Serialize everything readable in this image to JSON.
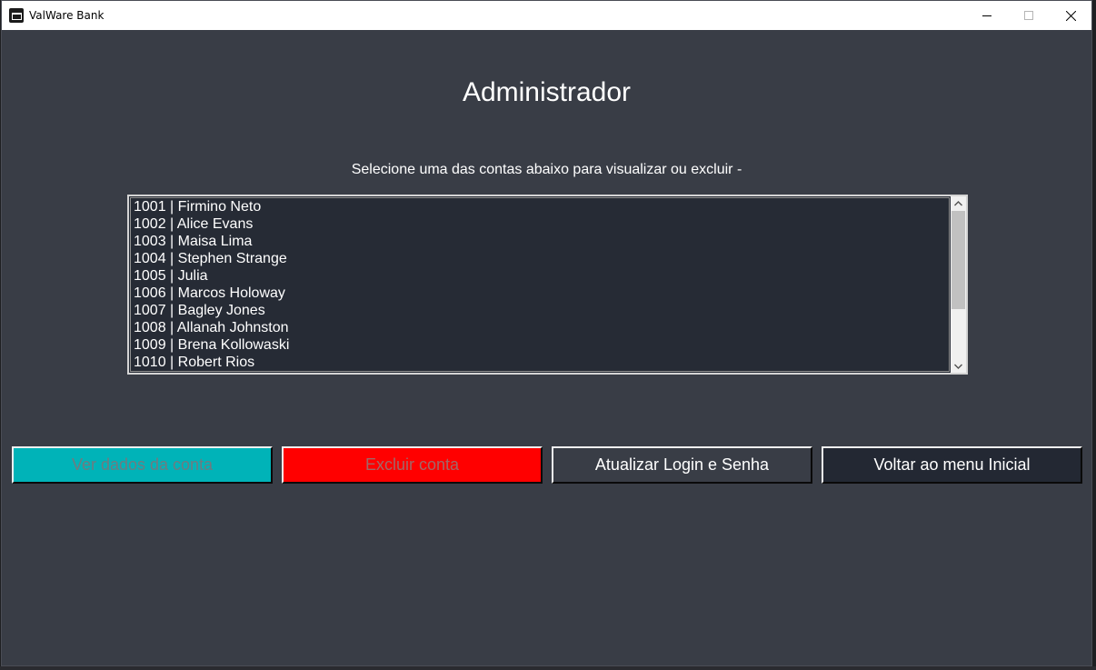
{
  "window": {
    "title": "ValWare Bank"
  },
  "page": {
    "heading": "Administrador",
    "instruction": "Selecione uma das contas abaixo para visualizar ou excluir -"
  },
  "accounts": [
    "1001 | Firmino Neto",
    "1002 | Alice Evans",
    "1003 | Maisa Lima",
    "1004 | Stephen Strange",
    "1005 | Julia",
    "1006 | Marcos Holoway",
    "1007 | Bagley Jones",
    "1008 | Allanah Johnston",
    "1009 | Brena Kollowaski",
    "1010 | Robert Rios"
  ],
  "buttons": {
    "view": "Ver dados da conta",
    "delete": "Excluir conta",
    "update": "Atualizar Login e Senha",
    "back": "Voltar ao menu Inicial"
  },
  "icons": {
    "app": "bank-app-icon",
    "minimize": "minimize-icon",
    "maximize": "maximize-icon",
    "close": "close-icon",
    "scroll_up": "chevron-up-icon",
    "scroll_down": "chevron-down-icon"
  },
  "colors": {
    "background": "#393d46",
    "list_background": "#262b35",
    "view_button": "#00b3b8",
    "delete_button": "#ff0000",
    "update_button": "#393d46",
    "back_button": "#232833"
  }
}
